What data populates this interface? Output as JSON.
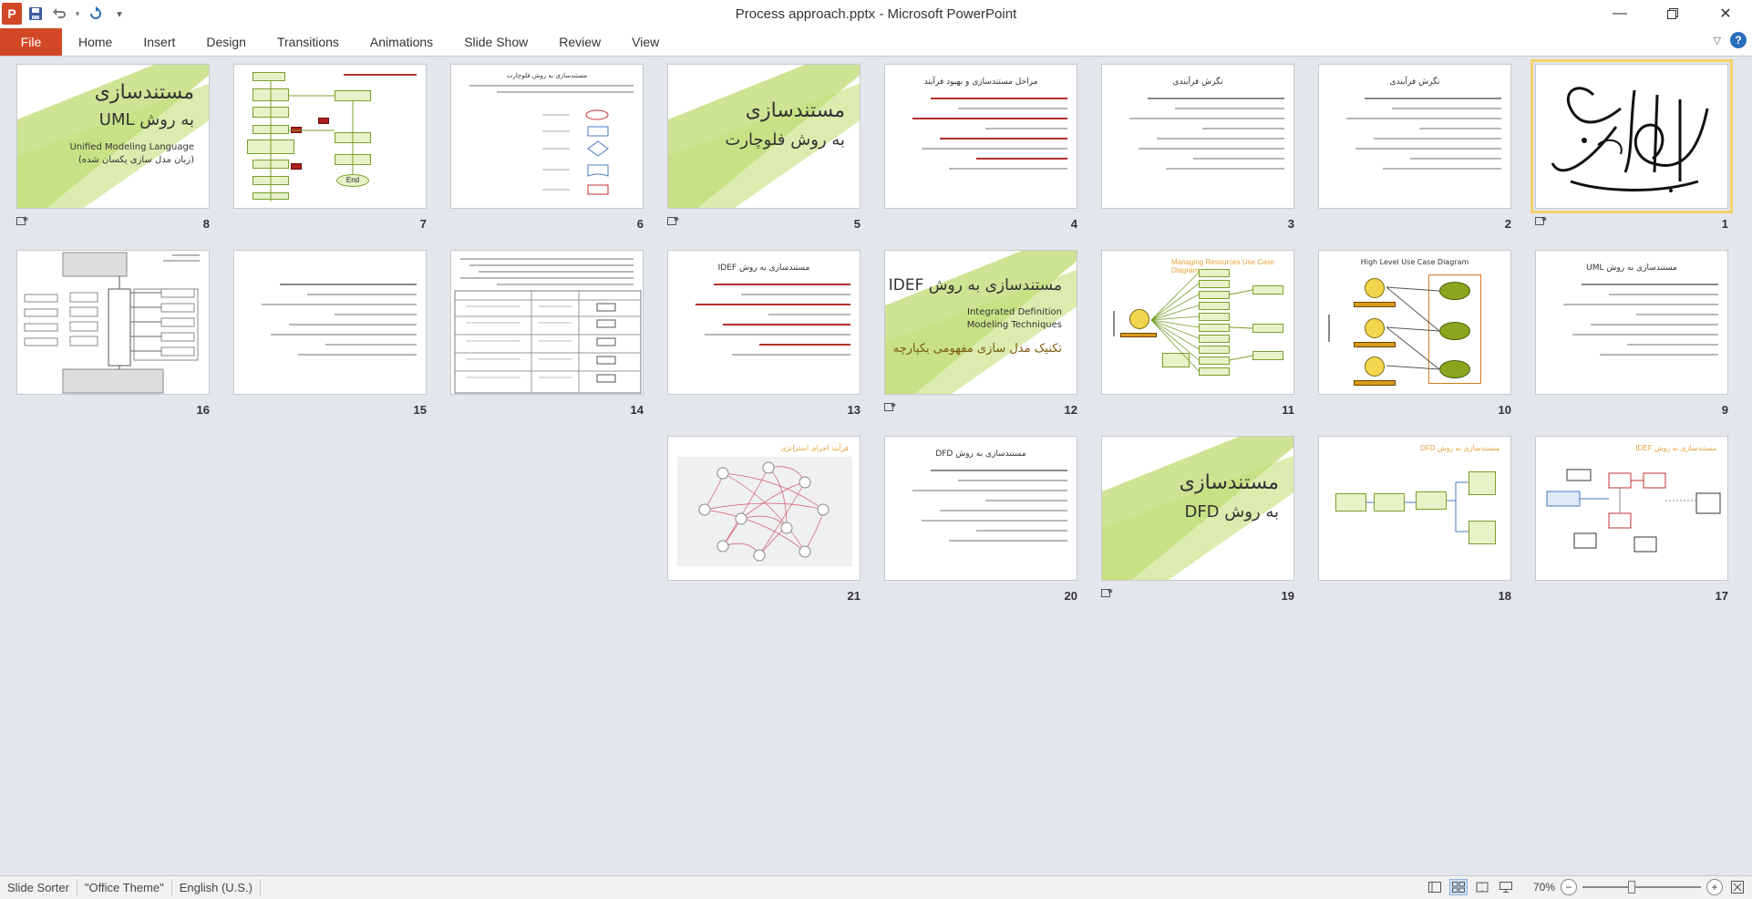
{
  "app": {
    "window_title": "Process approach.pptx - Microsoft PowerPoint",
    "app_letter": "P"
  },
  "ribbon": {
    "file": "File",
    "tabs": [
      "Home",
      "Insert",
      "Design",
      "Transitions",
      "Animations",
      "Slide Show",
      "Review",
      "View"
    ]
  },
  "slides": [
    {
      "number": "1",
      "selected": true,
      "has_transition": true,
      "kind": "calligraphy"
    },
    {
      "number": "2",
      "title": "نگرش فرآیندی",
      "kind": "text"
    },
    {
      "number": "3",
      "title": "نگرش فرآیندی",
      "kind": "text"
    },
    {
      "number": "4",
      "title": "مراحل مستندسازی و بهبود فرآیند",
      "kind": "text-red"
    },
    {
      "number": "5",
      "has_transition": true,
      "kind": "section",
      "line1": "مستندسازی",
      "line2": "به روش فلوچارت"
    },
    {
      "number": "6",
      "title": "مستندسازی به روش فلوچارت",
      "kind": "shapes"
    },
    {
      "number": "7",
      "kind": "flowchart",
      "end_label": "End"
    },
    {
      "number": "8",
      "has_transition": true,
      "kind": "section-uml",
      "line1": "مستندسازی",
      "line2": "به روش UML",
      "line3": "Unified Modeling Language",
      "line4": "(زبان مدل سازی یکسان شده)"
    },
    {
      "number": "9",
      "title": "مستندسازی به روش UML",
      "kind": "text"
    },
    {
      "number": "10",
      "title": "High Level Use Case Diagram",
      "kind": "usecase"
    },
    {
      "number": "11",
      "title": "Managing Resources Use Case Diagram",
      "kind": "resources"
    },
    {
      "number": "12",
      "has_transition": true,
      "kind": "section-idef",
      "line1": "مستندسازی به روش IDEF",
      "line2": "Integrated Definition",
      "line3": "Modeling Techniques",
      "line4": "تکنیک مدل سازی مفهومی یکپارچه"
    },
    {
      "number": "13",
      "title": "مستندسازی به روش IDEF",
      "kind": "text-red"
    },
    {
      "number": "14",
      "kind": "table"
    },
    {
      "number": "15",
      "kind": "text"
    },
    {
      "number": "16",
      "kind": "idef-diagram"
    },
    {
      "number": "17",
      "title": "مستندسازی به روش IDEF",
      "kind": "boxes"
    },
    {
      "number": "18",
      "title": "مستندسازی به روش DFD",
      "kind": "dfd"
    },
    {
      "number": "19",
      "has_transition": true,
      "kind": "section",
      "line1": "مستندسازی",
      "line2": "به روش DFD"
    },
    {
      "number": "20",
      "title": "مستندسازی به روش DFD",
      "kind": "text"
    },
    {
      "number": "21",
      "title": "فرآیند اجرای استراتژی",
      "kind": "network"
    }
  ],
  "status": {
    "view": "Slide Sorter",
    "theme": "\"Office Theme\"",
    "language": "English (U.S.)",
    "zoom": "70%"
  }
}
